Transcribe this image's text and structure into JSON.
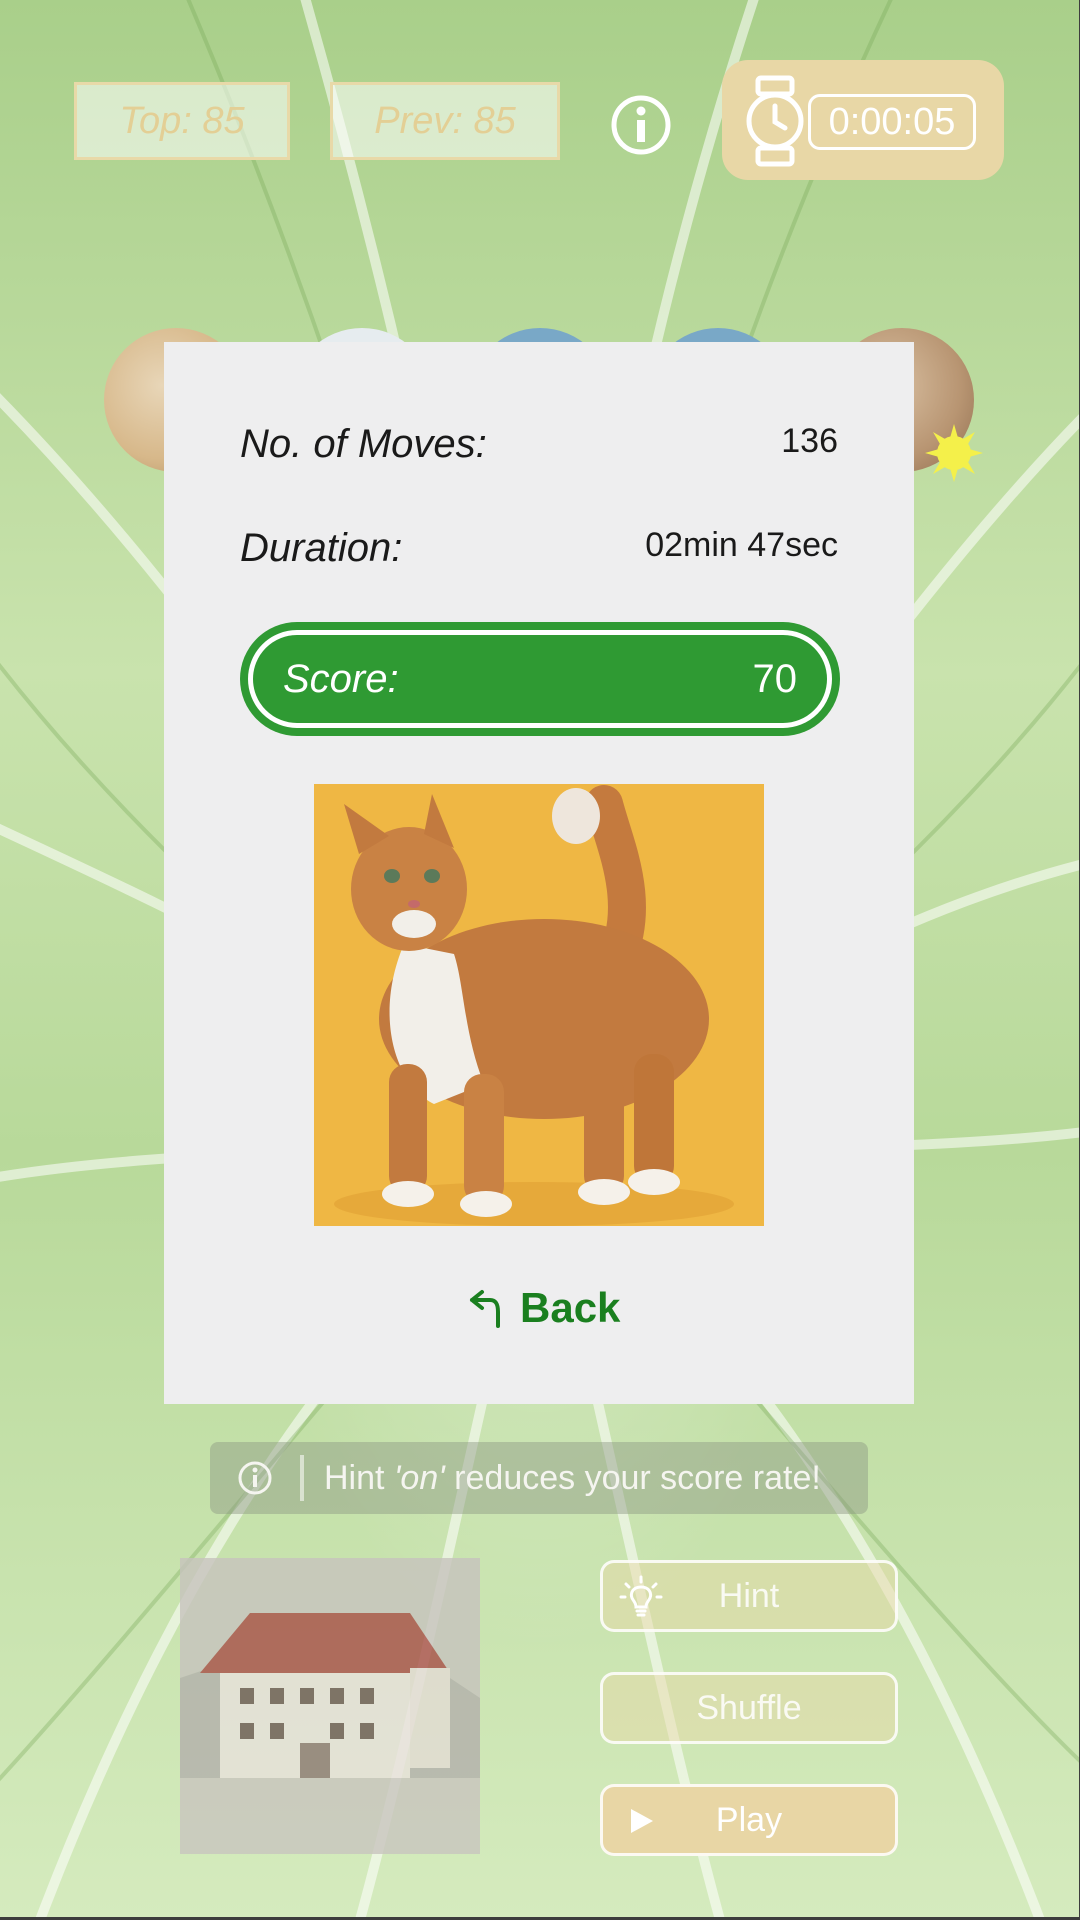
{
  "top_bar": {
    "top_score": "Top: 85",
    "prev_score": "Prev: 85",
    "timer": "0:00:05"
  },
  "result": {
    "moves_label": "No. of Moves:",
    "moves_value": "136",
    "duration_label": "Duration:",
    "duration_value": "02min 47sec",
    "score_label": "Score:",
    "score_value": "70",
    "back_label": "Back"
  },
  "hint_note": {
    "prefix": "Hint ",
    "emphasis": "'on'",
    "suffix": " reduces your score rate!"
  },
  "controls": {
    "hint_label": "Hint",
    "shuffle_label": "Shuffle",
    "play_label": "Play"
  },
  "colors": {
    "accent_green": "#2f9a33",
    "back_green": "#1a7f1f",
    "gold": "#e8d7a6"
  },
  "icons": {
    "info": "info-icon",
    "watch": "watch-icon",
    "back": "back-arrow-icon",
    "bulb": "lightbulb-icon",
    "play": "play-icon",
    "sun": "sun-badge-icon"
  }
}
